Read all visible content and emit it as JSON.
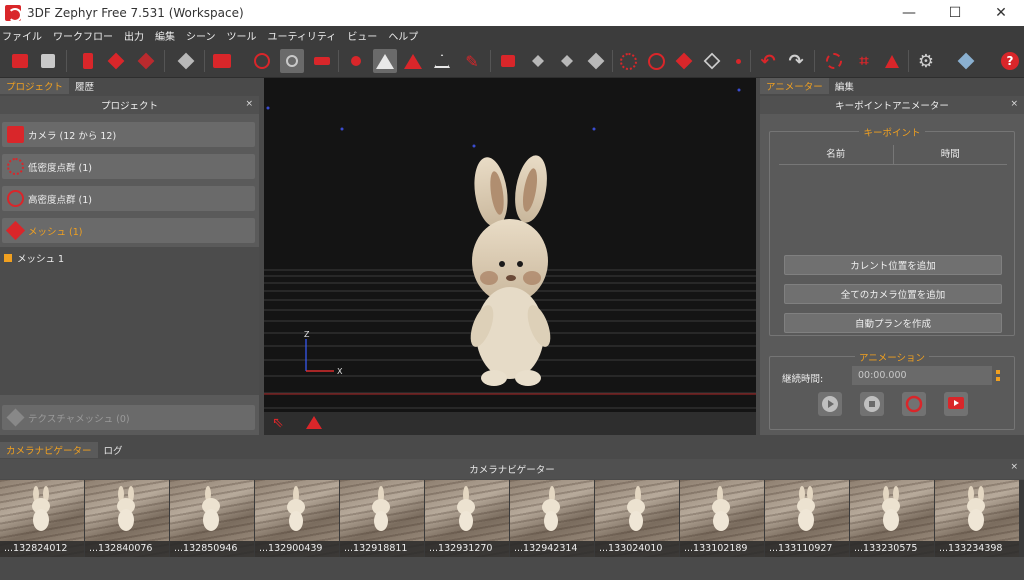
{
  "window": {
    "title": "3DF Zephyr Free 7.531 (Workspace)",
    "minimize": "—",
    "maximize": "☐",
    "close": "✕"
  },
  "menu": [
    "ファイル",
    "ワークフロー",
    "出力",
    "編集",
    "シーン",
    "ツール",
    "ユーティリティ",
    "ビュー",
    "ヘルプ"
  ],
  "left": {
    "tabs": [
      "プロジェクト",
      "履歴"
    ],
    "header": "プロジェクト",
    "close": "×",
    "items": [
      {
        "label": "カメラ (12  から 12)",
        "icon": "camera-icon"
      },
      {
        "label": "低密度点群 (1)",
        "icon": "sparse-cloud-icon"
      },
      {
        "label": "高密度点群 (1)",
        "icon": "dense-cloud-icon"
      },
      {
        "label": "メッシュ (1)",
        "icon": "mesh-icon"
      }
    ],
    "tree_item": "メッシュ 1",
    "textured": {
      "label": "テクスチャメッシュ (0)",
      "icon": "textured-mesh-icon"
    }
  },
  "viewport": {
    "axis_z": "Z",
    "axis_x": "X"
  },
  "right": {
    "tabs": [
      "アニメーター",
      "編集"
    ],
    "header": "キーポイントアニメーター",
    "close": "×",
    "keypoints": {
      "title": "キーポイント",
      "col_name": "名前",
      "col_time": "時間",
      "add_current": "カレント位置を追加",
      "add_all": "全てのカメラ位置を追加",
      "auto_plan": "自動プランを作成"
    },
    "animation": {
      "title": "アニメーション",
      "duration_label": "継続時間:",
      "duration_value": "00:00.000"
    }
  },
  "navigator": {
    "tabs": [
      "カメラナビゲーター",
      "ログ"
    ],
    "header": "カメラナビゲーター",
    "close": "×",
    "thumbs": [
      "...132824012",
      "...132840076",
      "...132850946",
      "...132900439",
      "...132918811",
      "...132931270",
      "...132942314",
      "...133024010",
      "...133102189",
      "...133110927",
      "...133230575",
      "...133234398"
    ]
  },
  "colors": {
    "accent": "#f0a020",
    "brand_red": "#d9262a",
    "panel": "#5a5a5a",
    "viewport": "#141414"
  }
}
